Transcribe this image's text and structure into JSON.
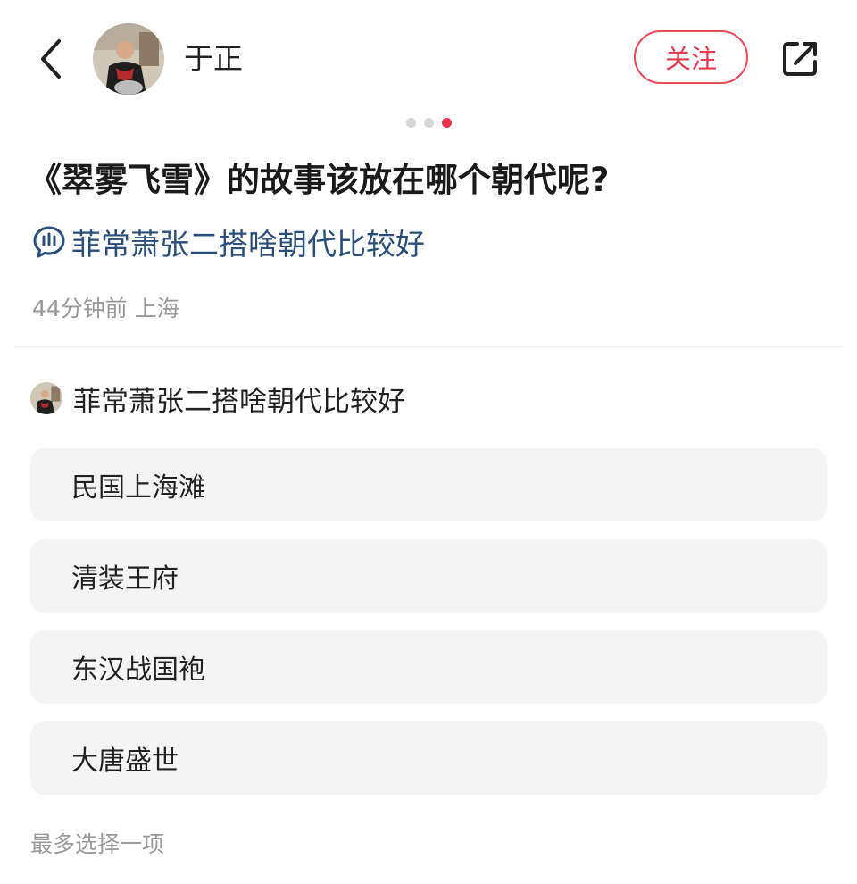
{
  "header": {
    "author_name": "于正",
    "follow_label": "关注",
    "back_icon": "chevron-left-icon",
    "share_icon": "share-icon",
    "accent_color": "#e23a4e"
  },
  "pager": {
    "total": 3,
    "active": 3
  },
  "post": {
    "title": "《翠雾飞雪》的故事该放在哪个朝代呢?",
    "topic": "菲常萧张二搭啥朝代比较好",
    "topic_color": "#2a4d7a",
    "meta": "44分钟前 上海"
  },
  "vote": {
    "title": "菲常萧张二搭啥朝代比较好",
    "options": [
      {
        "label": "民国上海滩"
      },
      {
        "label": "清装王府"
      },
      {
        "label": "东汉战国袍"
      },
      {
        "label": "大唐盛世"
      }
    ],
    "hint": "最多选择一项"
  }
}
